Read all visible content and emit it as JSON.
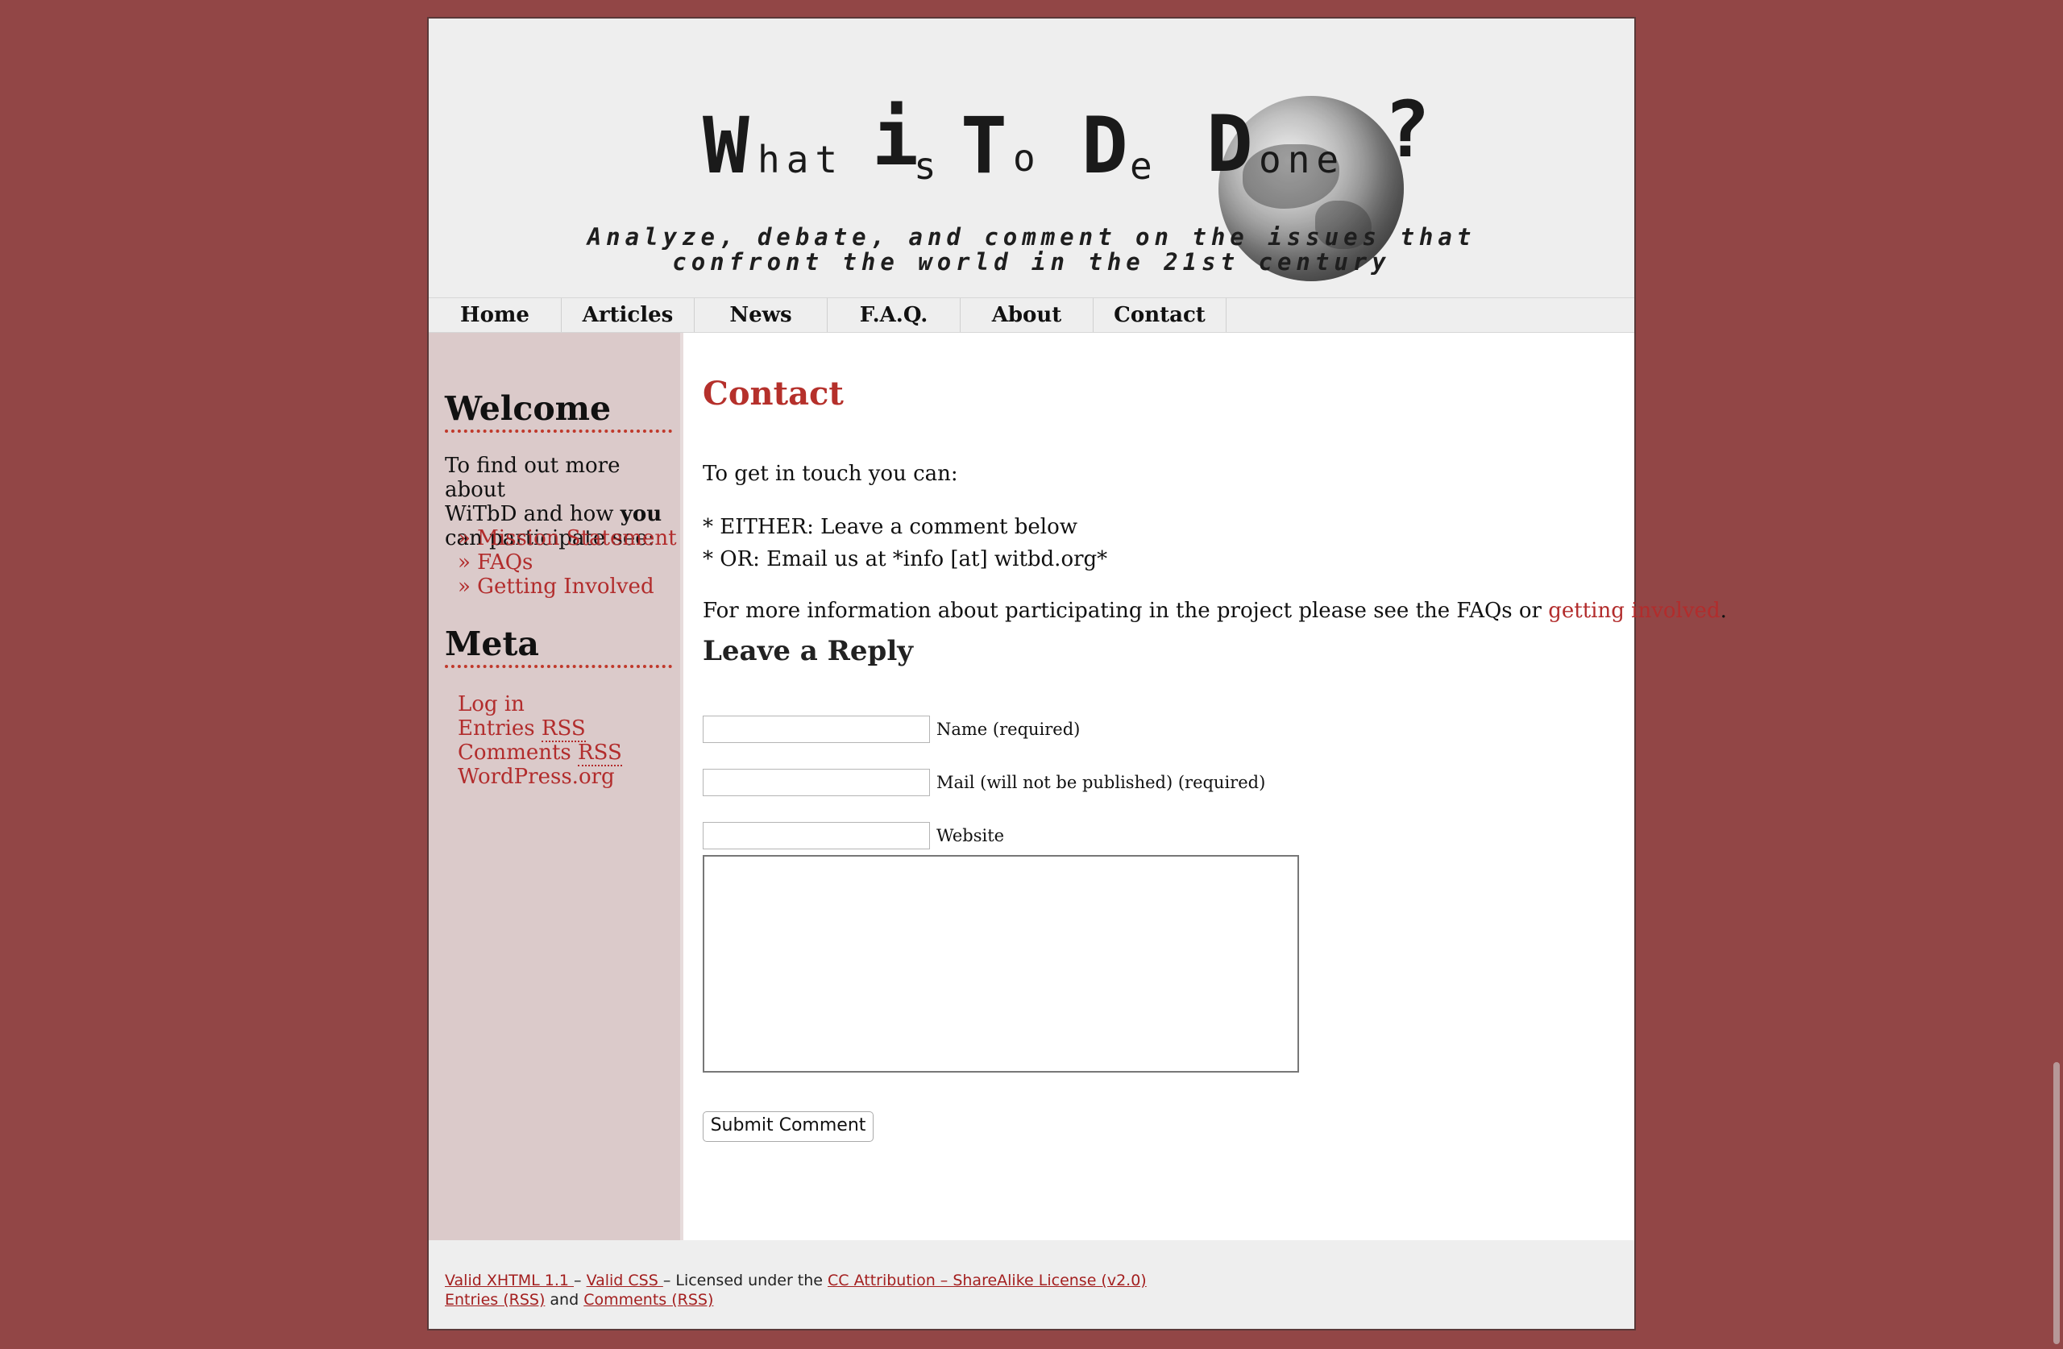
{
  "header": {
    "title_parts": [
      "W",
      "hat",
      "i",
      "s",
      "T",
      "o",
      "D",
      "e",
      "D",
      "one",
      "?"
    ],
    "tagline_line1": "Analyze, debate, and comment on the issues that",
    "tagline_line2": "confront the world in the 21st century"
  },
  "nav": [
    "Home",
    "Articles",
    "News",
    "F.A.Q.",
    "About",
    "Contact"
  ],
  "sidebar": {
    "welcome_heading": "Welcome",
    "welcome_text_1": "To find out more about",
    "welcome_text_2a": "WiTbD and how ",
    "welcome_text_2b": "you",
    "welcome_text_3": "can participate see:",
    "links": [
      "» Mission Statement",
      "» FAQs",
      "» Getting Involved"
    ],
    "meta_heading": "Meta",
    "meta_links": {
      "log_in": "Log in",
      "entries": "Entries",
      "comments": "Comments",
      "rss": "RSS",
      "wordpress": "WordPress.org"
    }
  },
  "content": {
    "title": "Contact",
    "intro": "To get in touch you can:",
    "either": "* EITHER: Leave a comment below",
    "or": "* OR: Email us at *info [at] witbd.org*",
    "more_info_prefix": "For more information about participating in the project please see the FAQs or ",
    "more_info_link": "getting involved",
    "more_info_suffix": ".",
    "reply_heading": "Leave a Reply",
    "fields": {
      "name_label": "Name (required)",
      "mail_label": "Mail (will not be published) (required)",
      "website_label": "Website",
      "name_value": "",
      "mail_value": "",
      "website_value": "",
      "comment_value": ""
    },
    "submit_label": "Submit Comment"
  },
  "footer": {
    "valid_xhtml": "Valid XHTML 1.1 ",
    "sep": " – ",
    "valid_css": "Valid CSS ",
    "licensed": " Licensed under the ",
    "license_link": "CC Attribution – ShareAlike License (v2.0)",
    "entries_rss": "Entries (RSS)",
    "and": " and ",
    "comments_rss": "Comments (RSS)"
  },
  "colors": {
    "background": "#924646",
    "accent": "#b22c2c",
    "sidebar": "#dbcaca",
    "header": "#eeeeee"
  }
}
